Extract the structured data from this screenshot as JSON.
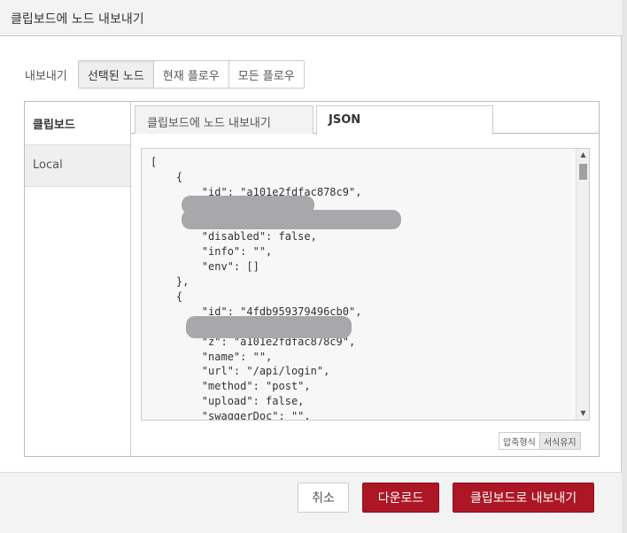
{
  "dialog": {
    "title": "클립보드에 노드 내보내기"
  },
  "export_scope": {
    "label": "내보내기",
    "options": [
      "선택된 노드",
      "현재 플로우",
      "모든 플로우"
    ],
    "selected": "선택된 노드"
  },
  "sidebar": {
    "header": "클립보드",
    "items": [
      {
        "label": "Local"
      }
    ]
  },
  "tabs": [
    {
      "label": "클립보드에 노드 내보내기",
      "active": false
    },
    {
      "label": "JSON",
      "active": true
    }
  ],
  "code": {
    "lines": [
      "[",
      "    {",
      "        \"id\": \"a101e2fdfac878c9\",",
      "",
      "",
      "        \"disabled\": false,",
      "        \"info\": \"\",",
      "        \"env\": []",
      "    },",
      "    {",
      "        \"id\": \"4fdb959379496cb0\",",
      "",
      "        \"z\": \"a101e2fdfac878c9\",",
      "        \"name\": \"\",",
      "        \"url\": \"/api/login\",",
      "        \"method\": \"post\",",
      "        \"upload\": false,",
      "        \"swaggerDoc\": \"\","
    ]
  },
  "format": {
    "options": [
      "압축형식",
      "서식유지"
    ],
    "selected": "서식유지"
  },
  "footer": {
    "cancel_label": "취소",
    "download_label": "다운로드",
    "export_label": "클립보드로 내보내기"
  },
  "colors": {
    "primary": "#ad1625",
    "redaction": "#a8a8aa"
  }
}
